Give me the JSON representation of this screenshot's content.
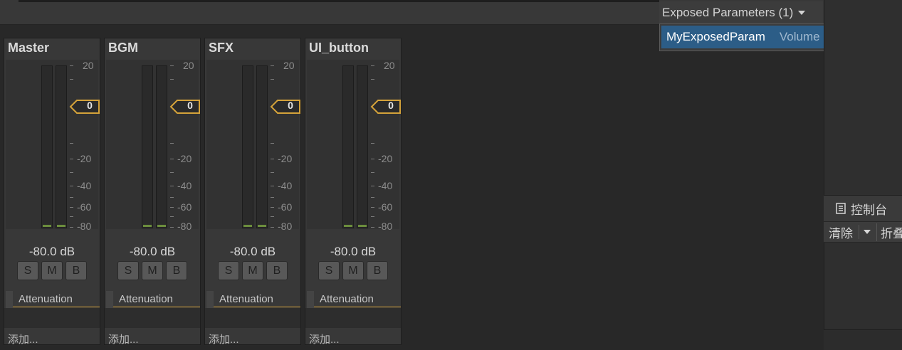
{
  "header": {
    "exposed_label": "Exposed Parameters (1)",
    "exposed_param_name": "MyExposedParam",
    "exposed_param_detail": "Volume (of BGM)"
  },
  "mixer": {
    "scale_labels": [
      "20",
      "-20",
      "-40",
      "-60",
      "-80"
    ],
    "strips": [
      {
        "name": "Master",
        "fader_value": "0",
        "db_label": "-80.0 dB",
        "buttons": [
          "S",
          "M",
          "B"
        ],
        "effect": "Attenuation",
        "add_label": "添加..."
      },
      {
        "name": "BGM",
        "fader_value": "0",
        "db_label": "-80.0 dB",
        "buttons": [
          "S",
          "M",
          "B"
        ],
        "effect": "Attenuation",
        "add_label": "添加..."
      },
      {
        "name": "SFX",
        "fader_value": "0",
        "db_label": "-80.0 dB",
        "buttons": [
          "S",
          "M",
          "B"
        ],
        "effect": "Attenuation",
        "add_label": "添加..."
      },
      {
        "name": "UI_button",
        "fader_value": "0",
        "db_label": "-80.0 dB",
        "buttons": [
          "S",
          "M",
          "B"
        ],
        "effect": "Attenuation",
        "add_label": "添加..."
      }
    ]
  },
  "console": {
    "tab_label": "控制台",
    "clear_label": "清除",
    "collapse_label": "折叠"
  },
  "colors": {
    "accent_fader": "#d5a33a",
    "selection": "#2c5d87",
    "meter_level": "#6c8e3d"
  }
}
